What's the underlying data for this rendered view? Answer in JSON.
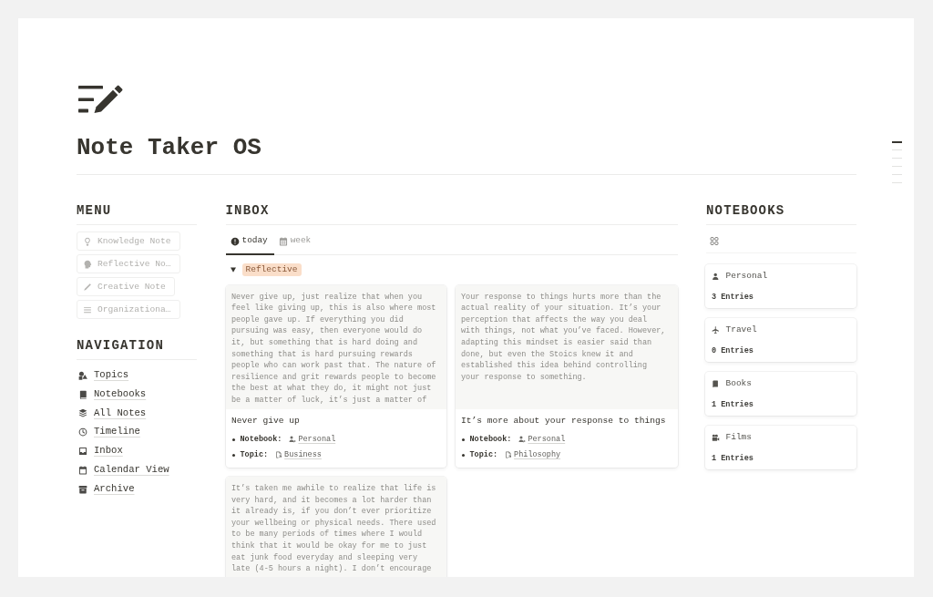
{
  "page": {
    "title": "Note Taker OS"
  },
  "menu": {
    "heading": "MENU",
    "items": [
      {
        "label": "Knowledge Note"
      },
      {
        "label": "Reflective No…"
      },
      {
        "label": "Creative Note"
      },
      {
        "label": "Organizationa…"
      }
    ]
  },
  "navigation": {
    "heading": "NAVIGATION",
    "items": [
      {
        "label": "Topics"
      },
      {
        "label": "Notebooks"
      },
      {
        "label": "All Notes"
      },
      {
        "label": "Timeline"
      },
      {
        "label": "Inbox"
      },
      {
        "label": "Calendar View"
      },
      {
        "label": "Archive"
      }
    ]
  },
  "inbox": {
    "heading": "INBOX",
    "tabs": [
      {
        "label": "today",
        "selected": true
      },
      {
        "label": "week",
        "selected": false
      }
    ],
    "groups": [
      {
        "label": "Reflective",
        "color": "#fadec9",
        "expanded": true,
        "cards": [
          {
            "preview": "Never give up, just realize that when you feel like giving up, this is also where most people gave up. If everything you did pursuing was easy, then everyone would do it, but something that is hard doing and something that is hard pursuing rewards people who can work past that. The nature of resilience and grit rewards people to become the best at what they do, it might not just be a matter of luck, it’s just a matter of",
            "title": "Never give up",
            "properties": [
              {
                "label": "Notebook:",
                "value": "Personal"
              },
              {
                "label": "Topic:",
                "value": "Business"
              }
            ]
          },
          {
            "preview": "Your response to things hurts more than the actual reality of your situation. It’s your perception that affects the way you deal with things, not what you’ve faced. However, adapting this mindset is easier said than done, but even the Stoics knew it and established this idea behind controlling your response to something.",
            "title": "It’s more about your response to things",
            "properties": [
              {
                "label": "Notebook:",
                "value": "Personal"
              },
              {
                "label": "Topic:",
                "value": "Philosophy"
              }
            ]
          },
          {
            "preview": "It’s taken me awhile to realize that life is very hard, and it becomes a lot harder than it already is, if you don’t ever prioritize your wellbeing or physical needs. There used to be many periods of times where I would think that it would be okay for me to just eat junk food everyday and sleeping very late (4-5 hours a night). I don’t encourage"
          }
        ]
      }
    ]
  },
  "notebooks": {
    "heading": "NOTEBOOKS",
    "items": [
      {
        "name": "Personal",
        "count": "3 Entries"
      },
      {
        "name": "Travel",
        "count": "0 Entries"
      },
      {
        "name": "Books",
        "count": "1 Entries"
      },
      {
        "name": "Films",
        "count": "1 Entries"
      }
    ]
  }
}
